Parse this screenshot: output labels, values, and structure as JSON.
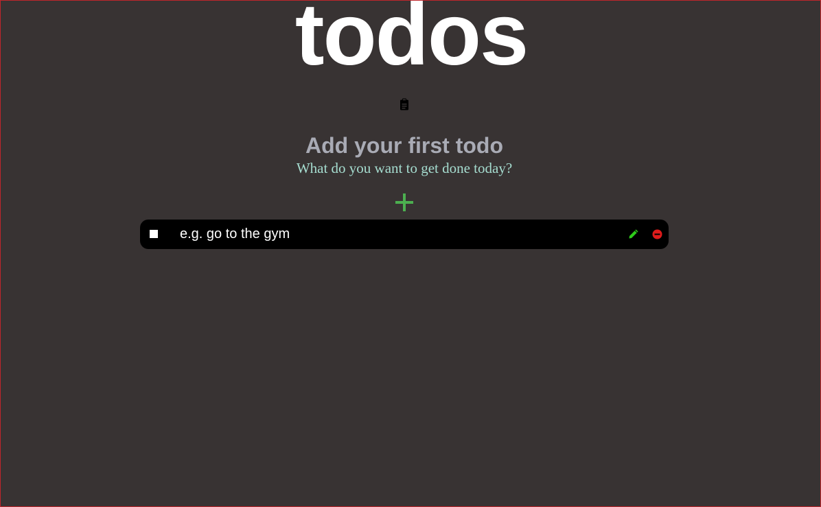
{
  "app": {
    "title": "todos"
  },
  "empty_state": {
    "icon": "clipboard-list-icon",
    "heading": "Add your first todo",
    "subheading": "What do you want to get done today?"
  },
  "add_button": {
    "icon": "plus-icon",
    "color": "#4caf50"
  },
  "todo_item": {
    "checked": false,
    "placeholder": "e.g. go to the gym",
    "value": "",
    "edit_icon": "pencil-icon",
    "edit_color": "#2ecc1a",
    "delete_icon": "minus-circle-icon",
    "delete_color": "#e01b1b"
  },
  "colors": {
    "background": "#383333",
    "title": "#ffffff",
    "heading": "#a9abb5",
    "subheading": "#a6ddd0",
    "row_background": "#000000",
    "frame_border": "#c0262c"
  }
}
